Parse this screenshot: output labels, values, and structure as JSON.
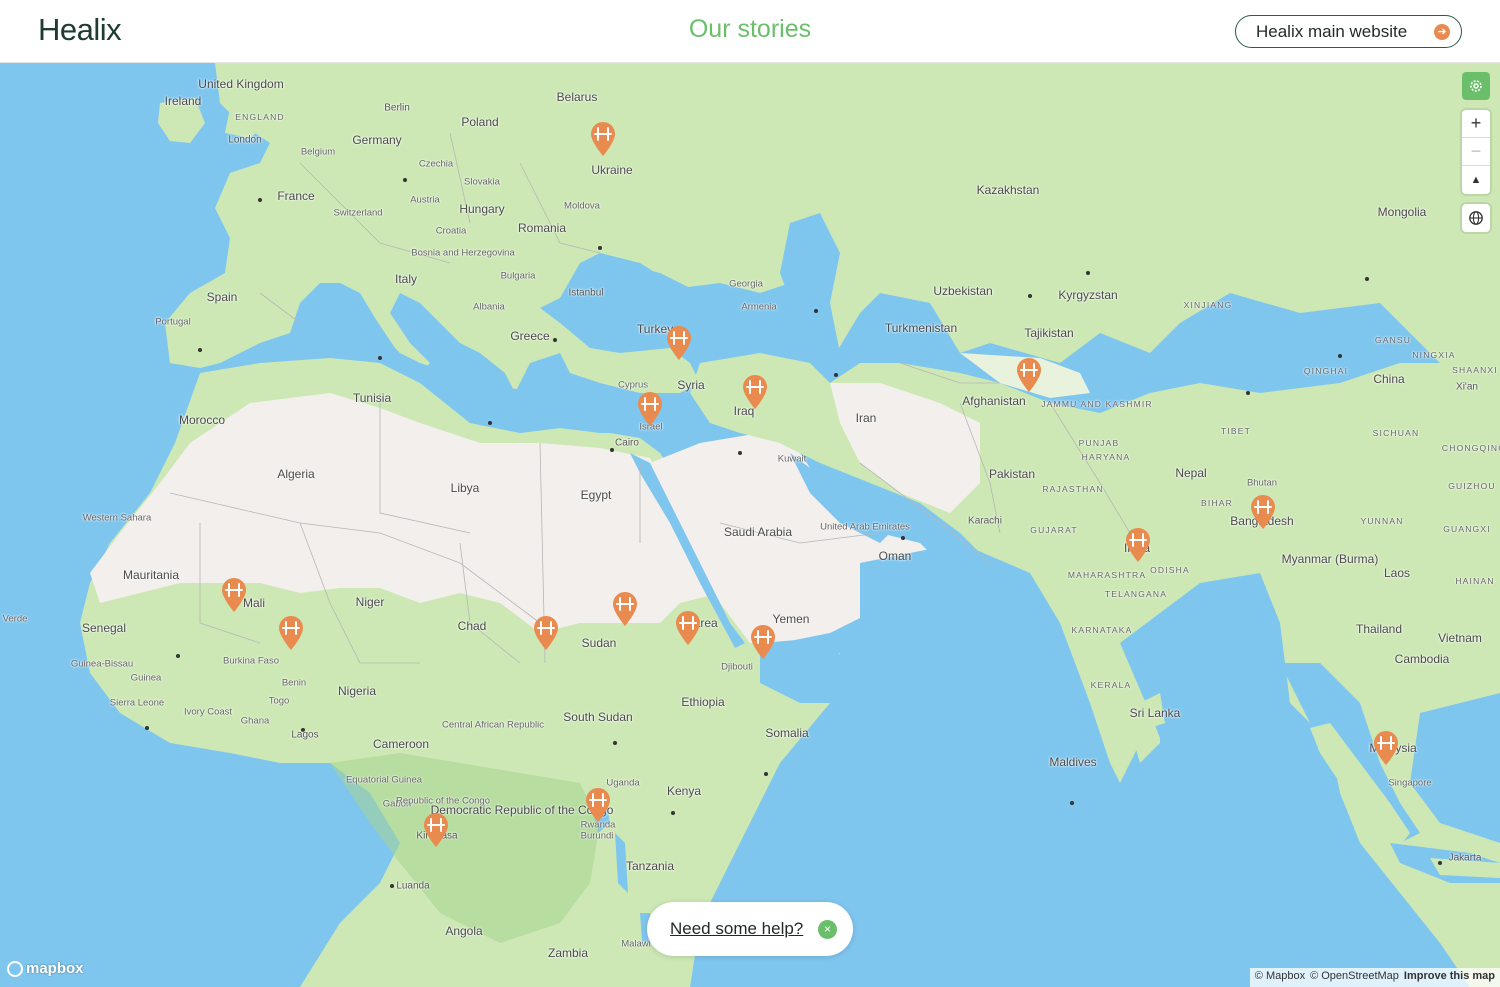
{
  "header": {
    "logo": "Healix",
    "title": "Our stories",
    "main_site_button": "Healix main website"
  },
  "map": {
    "labels": [
      {
        "text": "United Kingdom",
        "cls": ""
      },
      {
        "text": "Ireland",
        "cls": ""
      },
      {
        "text": "ENGLAND",
        "cls": "region"
      },
      {
        "text": "London",
        "cls": "city"
      },
      {
        "text": "Berlin",
        "cls": "city"
      },
      {
        "text": "Germany",
        "cls": ""
      },
      {
        "text": "Belgium",
        "cls": "small"
      },
      {
        "text": "Poland",
        "cls": ""
      },
      {
        "text": "Belarus",
        "cls": ""
      },
      {
        "text": "Ukraine",
        "cls": ""
      },
      {
        "text": "Czechia",
        "cls": "small"
      },
      {
        "text": "Slovakia",
        "cls": "small"
      },
      {
        "text": "Austria",
        "cls": "small"
      },
      {
        "text": "Hungary",
        "cls": ""
      },
      {
        "text": "Moldova",
        "cls": "small"
      },
      {
        "text": "Romania",
        "cls": ""
      },
      {
        "text": "France",
        "cls": ""
      },
      {
        "text": "Switzerland",
        "cls": "small"
      },
      {
        "text": "Croatia",
        "cls": "small"
      },
      {
        "text": "Bosnia and Herzegovina",
        "cls": "small"
      },
      {
        "text": "Bulgaria",
        "cls": "small"
      },
      {
        "text": "Istanbul",
        "cls": "city"
      },
      {
        "text": "Italy",
        "cls": ""
      },
      {
        "text": "Albania",
        "cls": "small"
      },
      {
        "text": "Greece",
        "cls": ""
      },
      {
        "text": "Spain",
        "cls": ""
      },
      {
        "text": "Portugal",
        "cls": "small"
      },
      {
        "text": "Georgia",
        "cls": "small"
      },
      {
        "text": "Armenia",
        "cls": "small"
      },
      {
        "text": "Turkey",
        "cls": ""
      },
      {
        "text": "Cyprus",
        "cls": "small"
      },
      {
        "text": "Syria",
        "cls": ""
      },
      {
        "text": "Israel",
        "cls": "small"
      },
      {
        "text": "Iraq",
        "cls": ""
      },
      {
        "text": "Cairo",
        "cls": "city"
      },
      {
        "text": "Kuwait",
        "cls": "small"
      },
      {
        "text": "Kazakhstan",
        "cls": ""
      },
      {
        "text": "Mongolia",
        "cls": ""
      },
      {
        "text": "Uzbekistan",
        "cls": ""
      },
      {
        "text": "Kyrgyzstan",
        "cls": ""
      },
      {
        "text": "Turkmenistan",
        "cls": ""
      },
      {
        "text": "Tajikistan",
        "cls": ""
      },
      {
        "text": "XINJIANG",
        "cls": "region"
      },
      {
        "text": "GANSU",
        "cls": "region"
      },
      {
        "text": "NINGXIA",
        "cls": "region"
      },
      {
        "text": "QINGHAI",
        "cls": "region"
      },
      {
        "text": "China",
        "cls": ""
      },
      {
        "text": "SHAANXI",
        "cls": "region"
      },
      {
        "text": "Xi'an",
        "cls": "city"
      },
      {
        "text": "Iran",
        "cls": ""
      },
      {
        "text": "Afghanistan",
        "cls": ""
      },
      {
        "text": "JAMMU AND KASHMIR",
        "cls": "region"
      },
      {
        "text": "TIBET",
        "cls": "region"
      },
      {
        "text": "SICHUAN",
        "cls": "region"
      },
      {
        "text": "CHONGQING",
        "cls": "region"
      },
      {
        "text": "PUNJAB",
        "cls": "region"
      },
      {
        "text": "HARYANA",
        "cls": "region"
      },
      {
        "text": "Pakistan",
        "cls": ""
      },
      {
        "text": "Nepal",
        "cls": ""
      },
      {
        "text": "Bhutan",
        "cls": "small"
      },
      {
        "text": "GUIZHOU",
        "cls": "region"
      },
      {
        "text": "RAJASTHAN",
        "cls": "region"
      },
      {
        "text": "BIHAR",
        "cls": "region"
      },
      {
        "text": "Bangladesh",
        "cls": ""
      },
      {
        "text": "YUNNAN",
        "cls": "region"
      },
      {
        "text": "GUANGXI",
        "cls": "region"
      },
      {
        "text": "Karachi",
        "cls": "city"
      },
      {
        "text": "GUJARAT",
        "cls": "region"
      },
      {
        "text": "India",
        "cls": ""
      },
      {
        "text": "Myanmar (Burma)",
        "cls": ""
      },
      {
        "text": "Laos",
        "cls": ""
      },
      {
        "text": "HAINAN",
        "cls": "region"
      },
      {
        "text": "MAHARASHTRA",
        "cls": "region"
      },
      {
        "text": "ODISHA",
        "cls": "region"
      },
      {
        "text": "TELANGANA",
        "cls": "region"
      },
      {
        "text": "Thailand",
        "cls": ""
      },
      {
        "text": "Vietnam",
        "cls": ""
      },
      {
        "text": "Cambodia",
        "cls": ""
      },
      {
        "text": "KARNATAKA",
        "cls": "region"
      },
      {
        "text": "KERALA",
        "cls": "region"
      },
      {
        "text": "Sri Lanka",
        "cls": ""
      },
      {
        "text": "Maldives",
        "cls": ""
      },
      {
        "text": "Malaysia",
        "cls": ""
      },
      {
        "text": "Singapore",
        "cls": "small"
      },
      {
        "text": "Jakarta",
        "cls": "city"
      },
      {
        "text": "Tunisia",
        "cls": ""
      },
      {
        "text": "Morocco",
        "cls": ""
      },
      {
        "text": "Algeria",
        "cls": ""
      },
      {
        "text": "Libya",
        "cls": ""
      },
      {
        "text": "Egypt",
        "cls": ""
      },
      {
        "text": "Saudi Arabia",
        "cls": ""
      },
      {
        "text": "United Arab Emirates",
        "cls": "small"
      },
      {
        "text": "Oman",
        "cls": ""
      },
      {
        "text": "Western Sahara",
        "cls": "small"
      },
      {
        "text": "Mauritania",
        "cls": ""
      },
      {
        "text": "Mali",
        "cls": ""
      },
      {
        "text": "Niger",
        "cls": ""
      },
      {
        "text": "Chad",
        "cls": ""
      },
      {
        "text": "Sudan",
        "cls": ""
      },
      {
        "text": "Eritrea",
        "cls": ""
      },
      {
        "text": "Yemen",
        "cls": ""
      },
      {
        "text": "Djibouti",
        "cls": "small"
      },
      {
        "text": "Verde",
        "cls": "small"
      },
      {
        "text": "Senegal",
        "cls": ""
      },
      {
        "text": "Guinea-Bissau",
        "cls": "small"
      },
      {
        "text": "Burkina Faso",
        "cls": "small"
      },
      {
        "text": "Guinea",
        "cls": "small"
      },
      {
        "text": "Benin",
        "cls": "small"
      },
      {
        "text": "Nigeria",
        "cls": ""
      },
      {
        "text": "Togo",
        "cls": "small"
      },
      {
        "text": "Sierra Leone",
        "cls": "small"
      },
      {
        "text": "Ivory Coast",
        "cls": "small"
      },
      {
        "text": "Ghana",
        "cls": "small"
      },
      {
        "text": "Lagos",
        "cls": "city"
      },
      {
        "text": "Central African Republic",
        "cls": "small"
      },
      {
        "text": "South Sudan",
        "cls": ""
      },
      {
        "text": "Ethiopia",
        "cls": ""
      },
      {
        "text": "Somalia",
        "cls": ""
      },
      {
        "text": "Cameroon",
        "cls": ""
      },
      {
        "text": "Equatorial Guinea",
        "cls": "small"
      },
      {
        "text": "Gabon",
        "cls": "small"
      },
      {
        "text": "Republic of the Congo",
        "cls": "small"
      },
      {
        "text": "Democratic Republic of the Congo",
        "cls": ""
      },
      {
        "text": "Uganda",
        "cls": "small"
      },
      {
        "text": "Kenya",
        "cls": ""
      },
      {
        "text": "Rwanda",
        "cls": "small"
      },
      {
        "text": "Burundi",
        "cls": "small"
      },
      {
        "text": "Kinshasa",
        "cls": "city"
      },
      {
        "text": "Tanzania",
        "cls": ""
      },
      {
        "text": "Luanda",
        "cls": "city"
      },
      {
        "text": "Angola",
        "cls": ""
      },
      {
        "text": "Zambia",
        "cls": ""
      },
      {
        "text": "Malawi",
        "cls": "small"
      }
    ],
    "markers": [
      "Ukraine",
      "Turkey",
      "Iraq",
      "Israel",
      "Afghanistan",
      "Bangladesh",
      "India",
      "Malaysia",
      "Mali",
      "Burkina Faso",
      "Sudan (west)",
      "Sudan",
      "Eritrea",
      "Yemen",
      "Democratic Republic of the Congo (east)",
      "Democratic Republic of the Congo (west)"
    ],
    "controls": {
      "zoom_in": "+",
      "zoom_out": "−",
      "compass": "▲",
      "globe": "globe-icon"
    }
  },
  "help": {
    "link": "Need some help?",
    "close": "×"
  },
  "attribution": {
    "logo": "mapbox",
    "mapbox": "© Mapbox",
    "osm": "© OpenStreetMap",
    "improve": "Improve this map"
  },
  "colors": {
    "accent_green": "#6cbf6a",
    "marker_orange": "#e98a4f",
    "water": "#7fc6ef",
    "land": "#cde8b5",
    "desert": "#f2efec"
  }
}
